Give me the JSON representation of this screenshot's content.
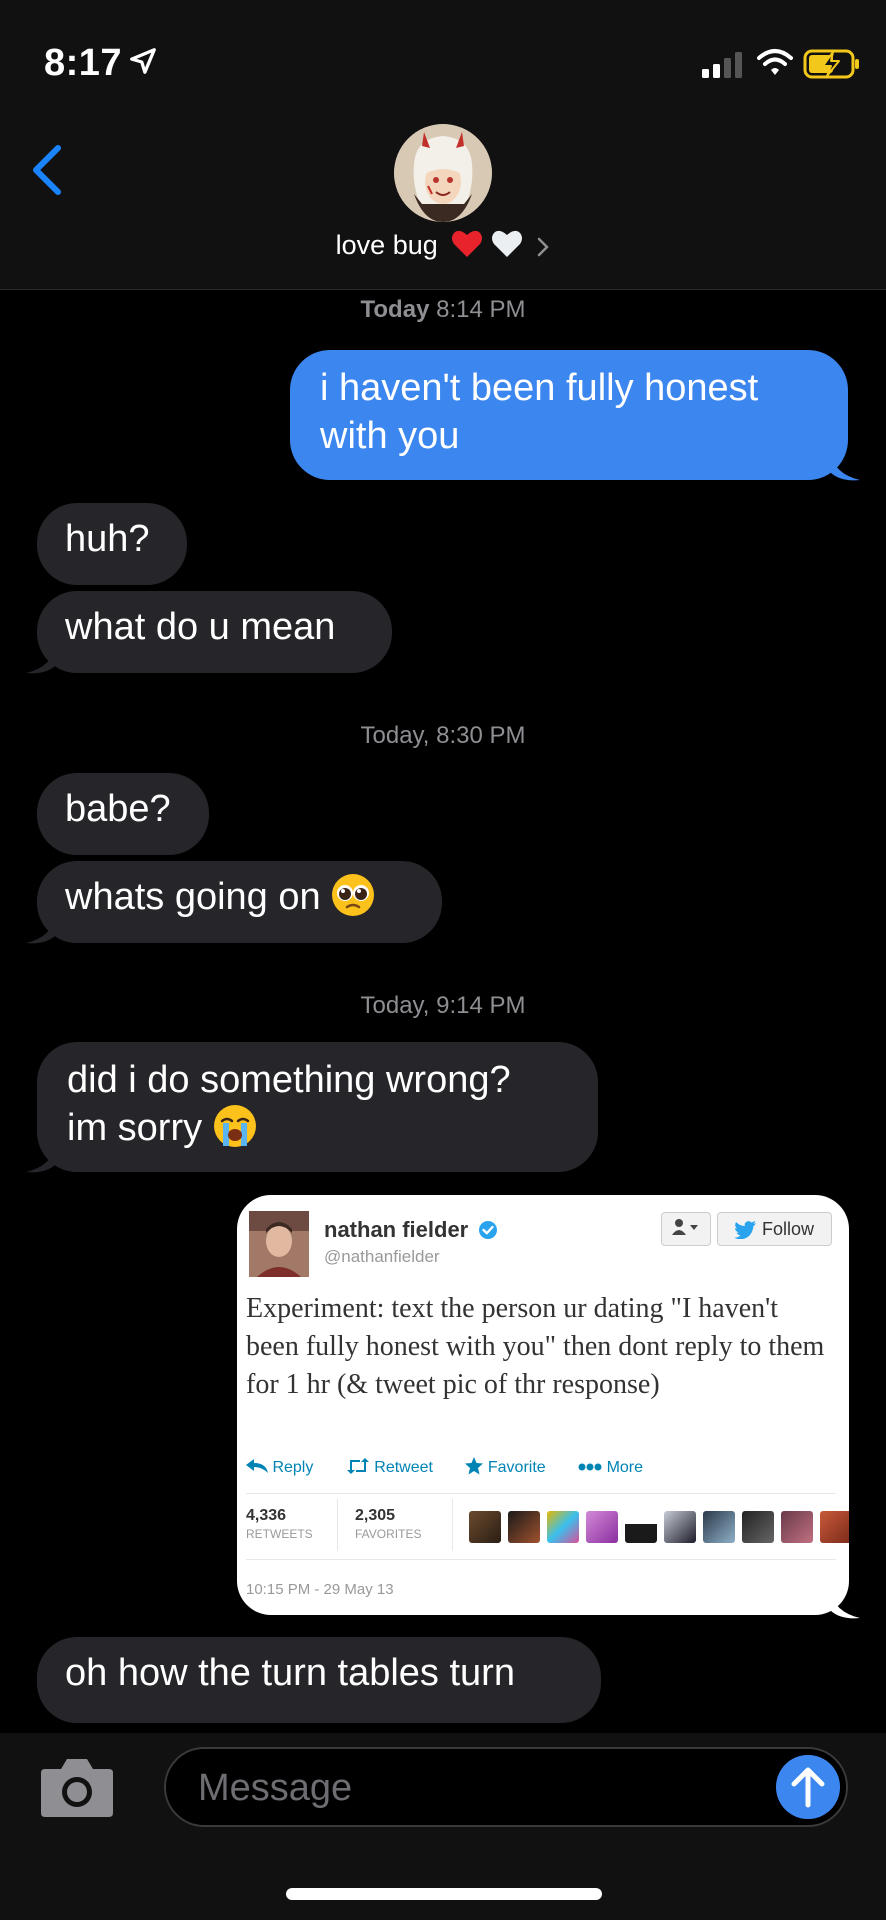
{
  "status_bar": {
    "time": "8:17"
  },
  "header": {
    "contact_name": "love bug",
    "icons": [
      "back-chevron-icon",
      "avatar",
      "red-heart-emoji",
      "white-heart-emoji",
      "chevron-right-icon"
    ]
  },
  "messages": {
    "ts1_bold": "Today",
    "ts1_time": " 8:14 PM",
    "sent1": "i haven't been fully honest with you",
    "recv1": "huh?",
    "recv2": "what do u mean",
    "ts2": "Today, 8:30 PM",
    "recv3": "babe?",
    "recv4": "whats going on",
    "ts3": "Today, 9:14 PM",
    "recv5_line1": "did i do something wrong?",
    "recv5_line2": "im sorry",
    "recv6": "oh how the turn tables turn"
  },
  "tweet": {
    "name": "nathan fielder",
    "handle": "@nathanfielder",
    "follow_label": "Follow",
    "text": "Experiment: text the person ur dating \"I haven't been fully honest with you\" then dont reply to them for 1 hr (& tweet pic of thr response)",
    "actions": {
      "reply": "Reply",
      "retweet": "Retweet",
      "favorite": "Favorite",
      "more": "More"
    },
    "retweets_count": "4,336",
    "retweets_label": "RETWEETS",
    "favorites_count": "2,305",
    "favorites_label": "FAVORITES",
    "timestamp": "10:15 PM - 29 May 13"
  },
  "compose": {
    "placeholder": "Message"
  },
  "colors": {
    "sent_bubble": "#3c86f0",
    "recv_bubble": "#26252a",
    "ios_blue": "#1a84ff"
  }
}
